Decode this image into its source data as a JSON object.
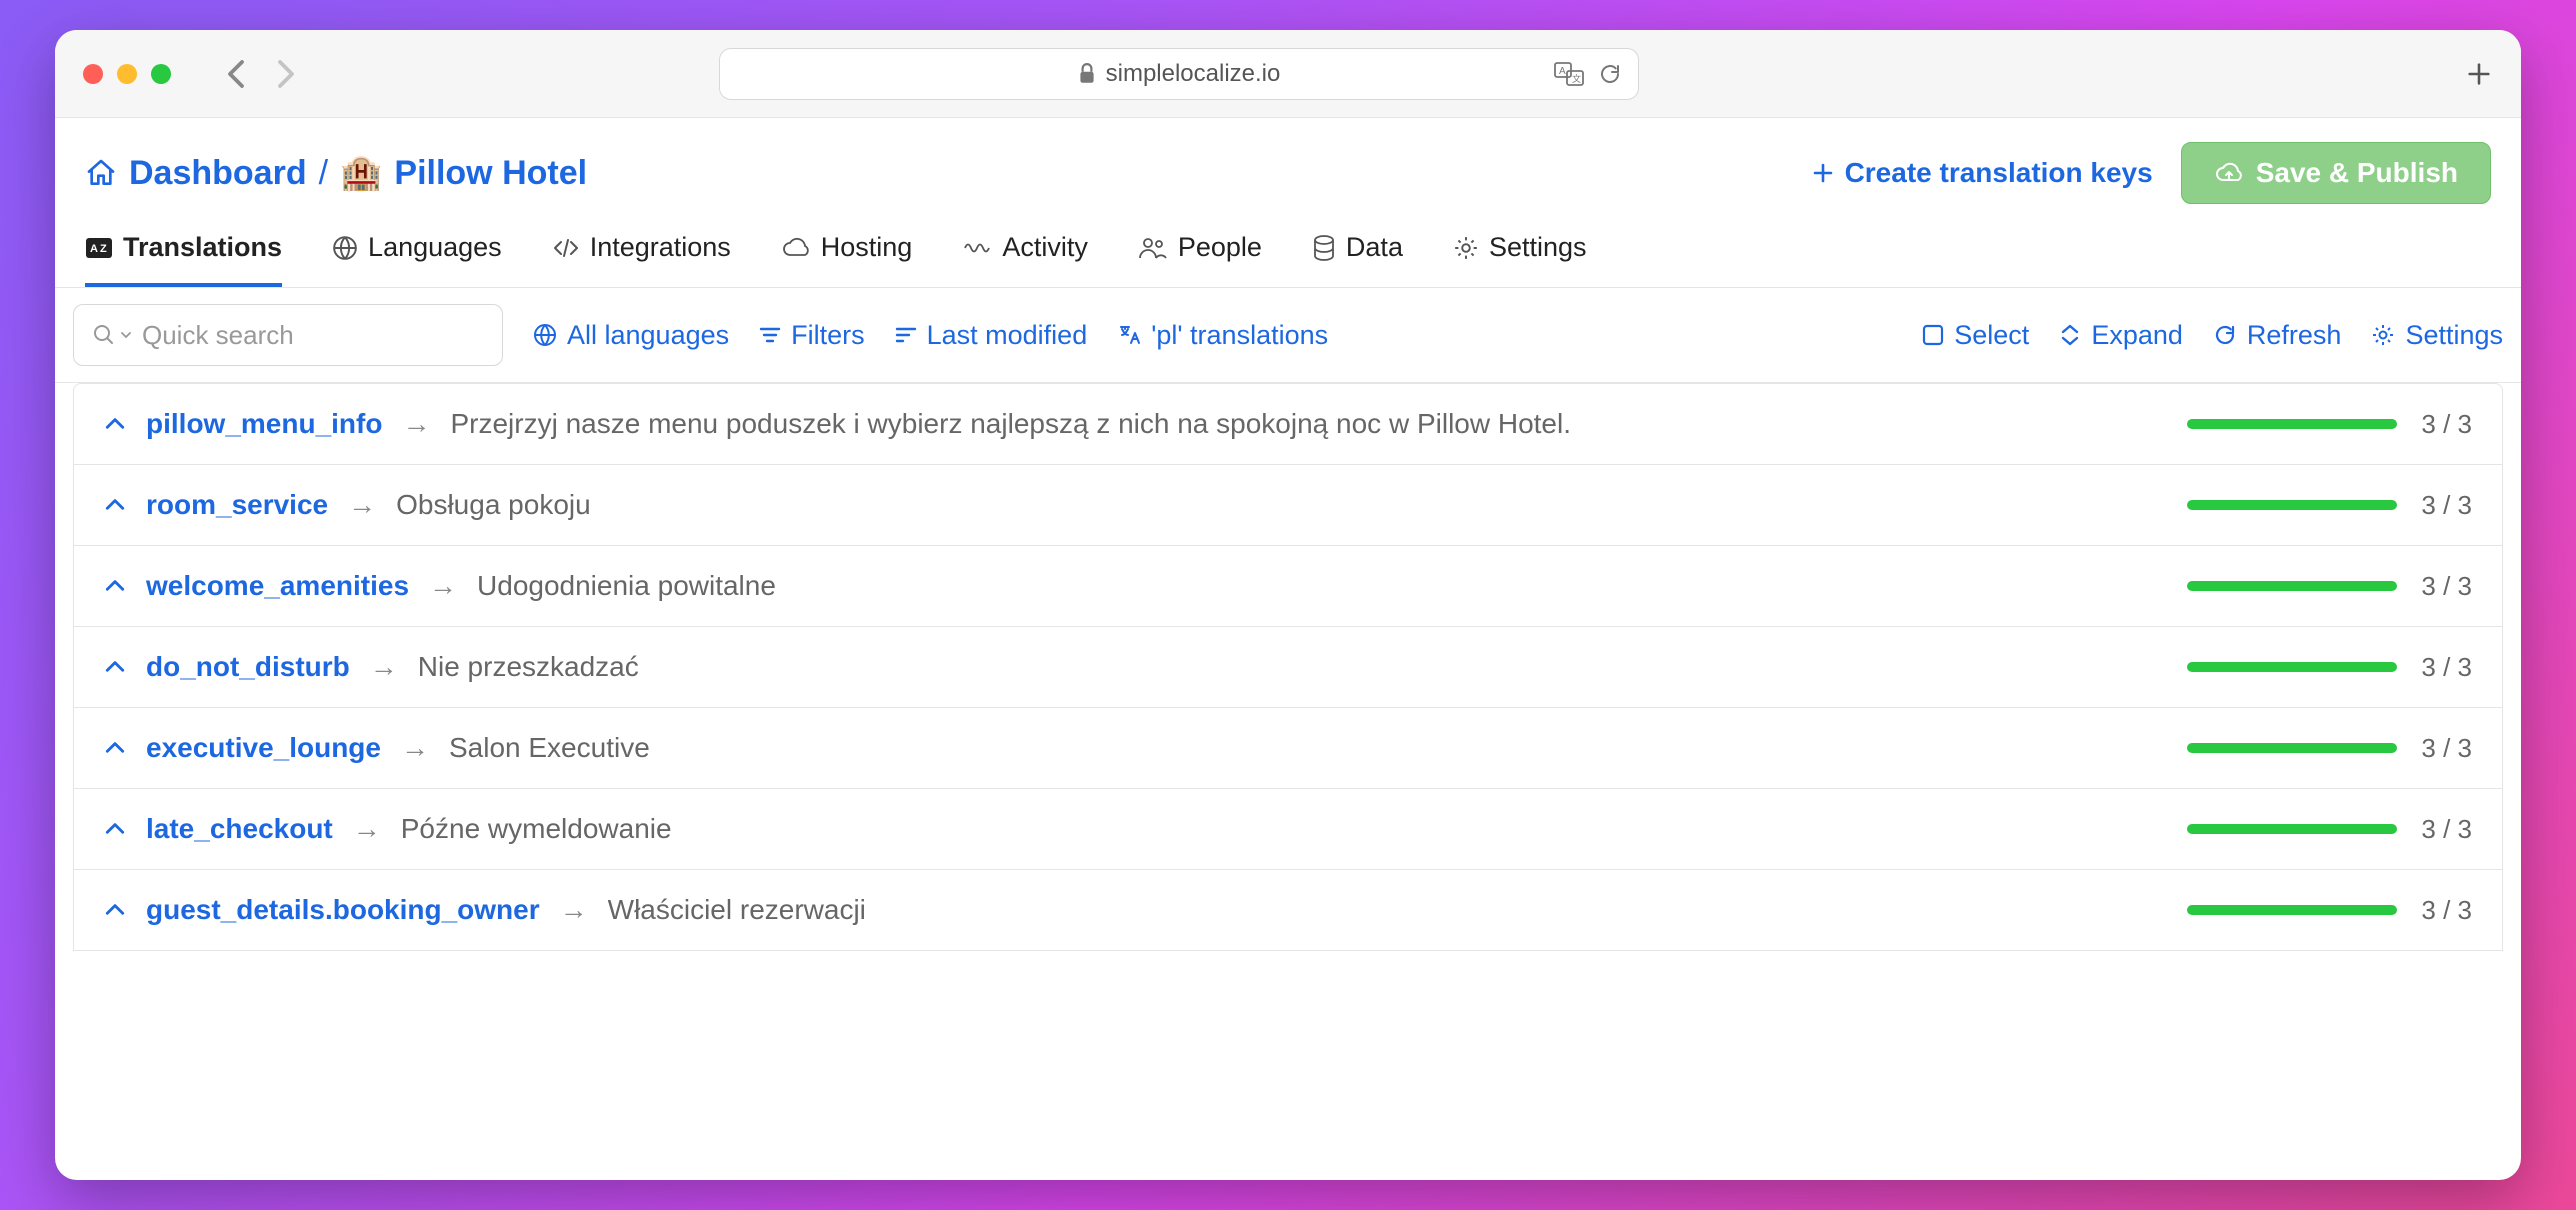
{
  "browser": {
    "url": "simplelocalize.io"
  },
  "breadcrumb": {
    "home": "Dashboard",
    "sep": "/",
    "project_emoji": "🏨",
    "project": "Pillow Hotel"
  },
  "header": {
    "create_keys": "Create translation keys",
    "save_publish": "Save & Publish"
  },
  "tabs": [
    {
      "label": "Translations",
      "active": true
    },
    {
      "label": "Languages",
      "active": false
    },
    {
      "label": "Integrations",
      "active": false
    },
    {
      "label": "Hosting",
      "active": false
    },
    {
      "label": "Activity",
      "active": false
    },
    {
      "label": "People",
      "active": false
    },
    {
      "label": "Data",
      "active": false
    },
    {
      "label": "Settings",
      "active": false
    }
  ],
  "toolbar": {
    "search_placeholder": "Quick search",
    "all_languages": "All languages",
    "filters": "Filters",
    "last_modified": "Last modified",
    "pl_translations": "'pl' translations",
    "select": "Select",
    "expand": "Expand",
    "refresh": "Refresh",
    "settings": "Settings"
  },
  "rows": [
    {
      "key": "pillow_menu_info",
      "preview": "Przejrzyj nasze menu poduszek i wybierz najlepszą z nich na spokojną noc w Pillow Hotel.",
      "count": "3 / 3"
    },
    {
      "key": "room_service",
      "preview": "Obsługa pokoju",
      "count": "3 / 3"
    },
    {
      "key": "welcome_amenities",
      "preview": "Udogodnienia powitalne",
      "count": "3 / 3"
    },
    {
      "key": "do_not_disturb",
      "preview": "Nie przeszkadzać",
      "count": "3 / 3"
    },
    {
      "key": "executive_lounge",
      "preview": "Salon Executive",
      "count": "3 / 3"
    },
    {
      "key": "late_checkout",
      "preview": "Późne wymeldowanie",
      "count": "3 / 3"
    },
    {
      "key": "guest_details.booking_owner",
      "preview": "Właściciel rezerwacji",
      "count": "3 / 3"
    }
  ]
}
